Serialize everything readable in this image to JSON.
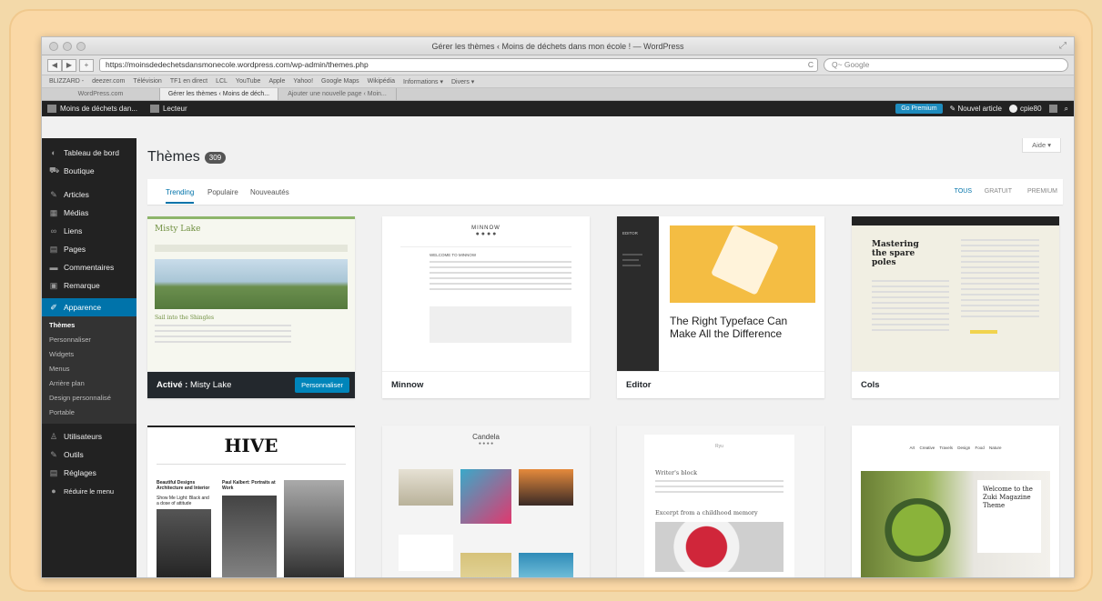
{
  "browser": {
    "window_title": "Gérer les thèmes ‹ Moins de déchets dans mon école ! — WordPress",
    "url": "https://moinsdedechetsdansmonecole.wordpress.com/wp-admin/themes.php",
    "search_placeholder": "Q~ Google",
    "bookmarks": [
      "BLIZZARD -",
      "deezer.com",
      "Télévision",
      "TF1 en direct",
      "LCL",
      "YouTube",
      "Apple",
      "Yahoo!",
      "Google Maps",
      "Wikipédia",
      "Informations ▾",
      "Divers ▾"
    ],
    "tabs": [
      "WordPress.com",
      "Gérer les thèmes ‹ Moins de déch...",
      "Ajouter une nouvelle page ‹ Moin..."
    ]
  },
  "adminbar": {
    "site_name": "Moins de déchets dan...",
    "reader": "Lecteur",
    "go_premium": "Go Premium",
    "new_post": "Nouvel article",
    "user": "cpie80"
  },
  "sidebar": {
    "items": [
      {
        "label": "Tableau de bord",
        "icon": "dashboard-icon"
      },
      {
        "label": "Boutique",
        "icon": "cart-icon"
      },
      {
        "label": "Articles",
        "icon": "pin-icon"
      },
      {
        "label": "Médias",
        "icon": "media-icon"
      },
      {
        "label": "Liens",
        "icon": "link-icon"
      },
      {
        "label": "Pages",
        "icon": "page-icon"
      },
      {
        "label": "Commentaires",
        "icon": "comment-icon"
      },
      {
        "label": "Remarque",
        "icon": "feedback-icon"
      }
    ],
    "active": "Apparence",
    "submenu": [
      "Thèmes",
      "Personnaliser",
      "Widgets",
      "Menus",
      "Arrière plan",
      "Design personnalisé",
      "Portable"
    ],
    "after": [
      "Utilisateurs",
      "Outils",
      "Réglages",
      "Réduire le menu"
    ]
  },
  "page": {
    "title": "Thèmes",
    "count": "309",
    "help": "Aide ▾",
    "filters": [
      "Trending",
      "Populaire",
      "Nouveautés"
    ],
    "price_filters": [
      "TOUS",
      "GRATUIT",
      "PREMIUM"
    ]
  },
  "themes": [
    {
      "name": "Misty Lake",
      "active_prefix": "Activé :",
      "customize": "Personnaliser",
      "shot_title": "Misty Lake",
      "shot_sub": "Sail into the Shingles"
    },
    {
      "name": "Minnow",
      "shot_title": "MINNOW",
      "shot_sub": "WELCOME TO MINNOW"
    },
    {
      "name": "Editor",
      "shot_title": "EDITOR",
      "shot_sub": "The Right Typeface Can Make All the Difference"
    },
    {
      "name": "Cols",
      "shot_title": "Mastering the spare poles"
    },
    {
      "shot_title": "HIVE",
      "shot_sub": "Beautiful Designs Architecture and Interior",
      "shot_sub2": "Paul Kalbert: Portraits at Work",
      "shot_sub3": "Show Me Light: Black and a dose of attitude"
    },
    {
      "shot_title": "Candela"
    },
    {
      "shot_title": "Ryu",
      "shot_sub": "Writer's block",
      "shot_sub2": "Excerpt from a childhood memory"
    },
    {
      "shot_title": "Welcome to the Zuki Magazine Theme",
      "shot_nav": "Art  Creative  Travels  Design  Food  Nature"
    }
  ],
  "colors": {
    "wp_blue": "#0073aa",
    "admin_dark": "#222222",
    "frame_bg": "#fad8a6"
  }
}
